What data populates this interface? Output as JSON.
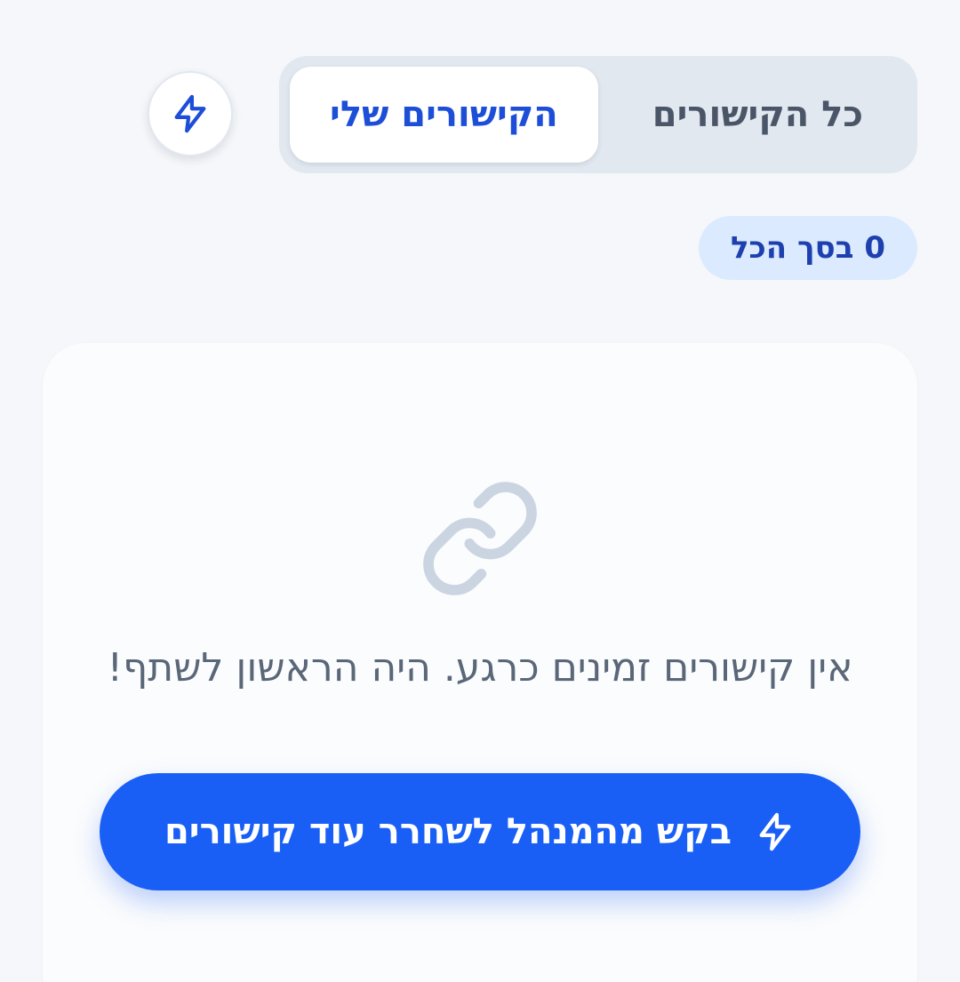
{
  "tabs": {
    "all_links": "כל הקישורים",
    "my_links": "הקישורים שלי"
  },
  "badge": {
    "total_text": "0 בסך הכל"
  },
  "empty_state": {
    "message": "אין קישורים זמינים כרגע. היה הראשון לשתף!",
    "cta_label": "בקש מהמנהל לשחרר עוד קישורים"
  },
  "icons": {
    "action_button": "lightning-bolt-icon",
    "empty_state": "link-icon",
    "cta": "lightning-bolt-icon"
  },
  "colors": {
    "accent": "#1a5ff5",
    "active_tab_text": "#1d4ed8",
    "badge_bg": "#dbeafe",
    "badge_text": "#1e40af",
    "tab_track": "#e2e8f0",
    "muted_icon": "#cbd5e1"
  }
}
